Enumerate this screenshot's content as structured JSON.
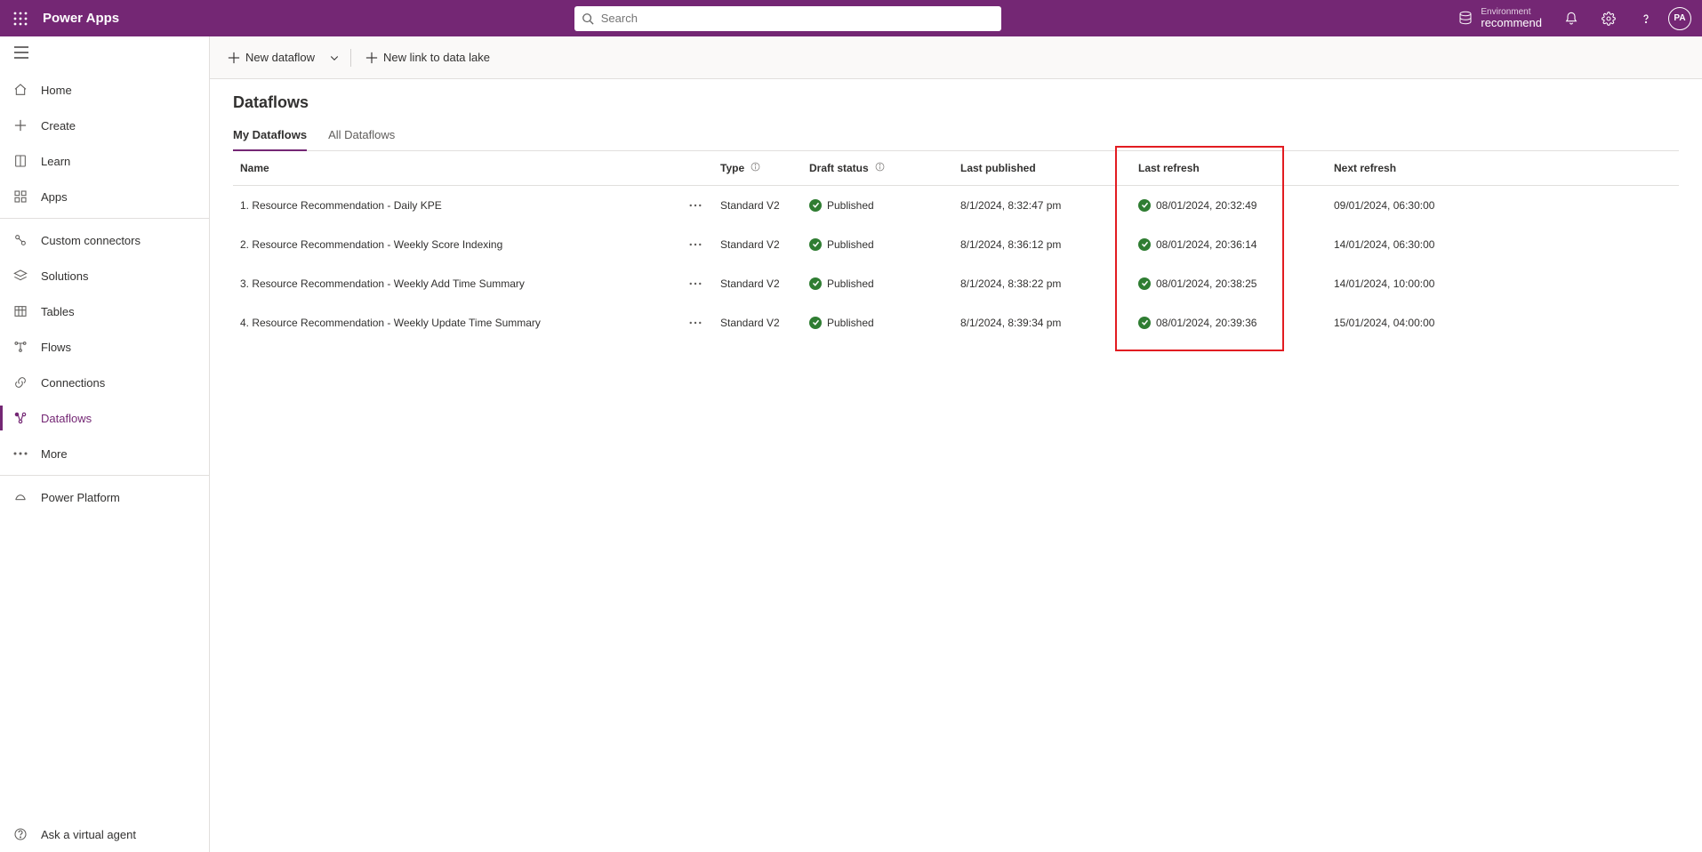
{
  "header": {
    "brand": "Power Apps",
    "search_placeholder": "Search",
    "env_label": "Environment",
    "env_name": "recommend",
    "avatar_initials": "PA"
  },
  "sidebar": {
    "groups": [
      [
        {
          "label": "Home",
          "name": "sidebar-item-home",
          "icon": "home-icon"
        },
        {
          "label": "Create",
          "name": "sidebar-item-create",
          "icon": "plus-icon"
        },
        {
          "label": "Learn",
          "name": "sidebar-item-learn",
          "icon": "book-icon"
        },
        {
          "label": "Apps",
          "name": "sidebar-item-apps",
          "icon": "apps-icon"
        }
      ],
      [
        {
          "label": "Custom connectors",
          "name": "sidebar-item-custom-connectors",
          "icon": "connector-icon"
        },
        {
          "label": "Solutions",
          "name": "sidebar-item-solutions",
          "icon": "layers-icon"
        },
        {
          "label": "Tables",
          "name": "sidebar-item-tables",
          "icon": "table-icon"
        },
        {
          "label": "Flows",
          "name": "sidebar-item-flows",
          "icon": "flow-icon"
        },
        {
          "label": "Connections",
          "name": "sidebar-item-connections",
          "icon": "link-icon"
        },
        {
          "label": "Dataflows",
          "name": "sidebar-item-dataflows",
          "icon": "dataflow-icon",
          "active": true
        },
        {
          "label": "More",
          "name": "sidebar-item-more",
          "icon": "dots-icon"
        }
      ],
      [
        {
          "label": "Power Platform",
          "name": "sidebar-item-power-platform",
          "icon": "platform-icon"
        }
      ]
    ],
    "footer_label": "Ask a virtual agent"
  },
  "commands": {
    "new_dataflow": "New dataflow",
    "new_link_lake": "New link to data lake"
  },
  "page": {
    "title": "Dataflows",
    "tabs": [
      {
        "label": "My Dataflows",
        "active": true
      },
      {
        "label": "All Dataflows",
        "active": false
      }
    ]
  },
  "table": {
    "columns": {
      "name": "Name",
      "type": "Type",
      "draft": "Draft status",
      "published": "Last published",
      "last_refresh": "Last refresh",
      "next_refresh": "Next refresh"
    },
    "rows": [
      {
        "name": "1. Resource Recommendation - Daily KPE",
        "type": "Standard V2",
        "draft": "Published",
        "published": "8/1/2024, 8:32:47 pm",
        "last_refresh": "08/01/2024, 20:32:49",
        "next_refresh": "09/01/2024, 06:30:00"
      },
      {
        "name": "2. Resource Recommendation - Weekly Score Indexing",
        "type": "Standard V2",
        "draft": "Published",
        "published": "8/1/2024, 8:36:12 pm",
        "last_refresh": "08/01/2024, 20:36:14",
        "next_refresh": "14/01/2024, 06:30:00"
      },
      {
        "name": "3. Resource Recommendation - Weekly Add Time Summary",
        "type": "Standard V2",
        "draft": "Published",
        "published": "8/1/2024, 8:38:22 pm",
        "last_refresh": "08/01/2024, 20:38:25",
        "next_refresh": "14/01/2024, 10:00:00"
      },
      {
        "name": "4. Resource Recommendation - Weekly Update Time Summary",
        "type": "Standard V2",
        "draft": "Published",
        "published": "8/1/2024, 8:39:34 pm",
        "last_refresh": "08/01/2024, 20:39:36",
        "next_refresh": "15/01/2024, 04:00:00"
      }
    ]
  }
}
